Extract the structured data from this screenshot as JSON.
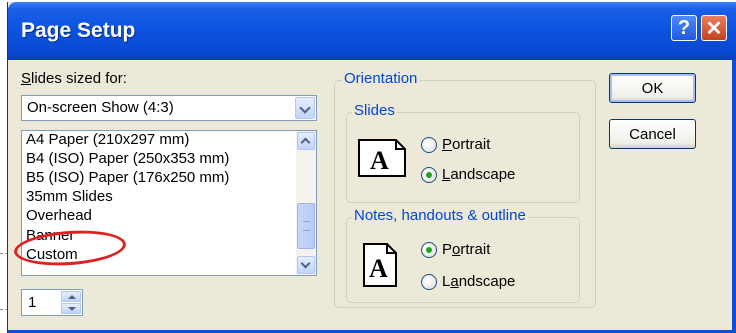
{
  "window": {
    "title": "Page Setup",
    "help_glyph": "?",
    "close_glyph": "✕"
  },
  "slides_sized_for": {
    "label_prefix": "S",
    "label_rest": "lides sized for:",
    "selected": "On-screen Show (4:3)",
    "options": [
      "A4 Paper (210x297 mm)",
      "B4 (ISO) Paper (250x353 mm)",
      "B5 (ISO) Paper (176x250 mm)",
      "35mm Slides",
      "Overhead",
      "Banner",
      "Custom"
    ]
  },
  "spinner": {
    "value": "1"
  },
  "orientation": {
    "title": "Orientation",
    "slides": {
      "title": "Slides",
      "portrait_key": "P",
      "portrait_rest": "ortrait",
      "landscape_key": "L",
      "landscape_rest": "andscape",
      "selected": "landscape"
    },
    "notes": {
      "title": "Notes, handouts & outline",
      "portrait_pre": "P",
      "portrait_key": "o",
      "portrait_rest": "rtrait",
      "landscape_pre": "L",
      "landscape_key": "a",
      "landscape_rest": "ndscape",
      "selected": "portrait"
    }
  },
  "buttons": {
    "ok": "OK",
    "cancel": "Cancel"
  },
  "icons": [
    "help-icon",
    "close-icon",
    "chevron-down-icon",
    "scroll-up-icon",
    "scroll-down-icon",
    "spin-up-icon",
    "spin-down-icon",
    "landscape-page-icon",
    "portrait-page-icon"
  ],
  "colors": {
    "titlebar": "#0b52e0",
    "dialog": "#ece9d8",
    "group_title": "#0046d5",
    "radio_dot": "#21a121",
    "highlight": "#e02020"
  }
}
